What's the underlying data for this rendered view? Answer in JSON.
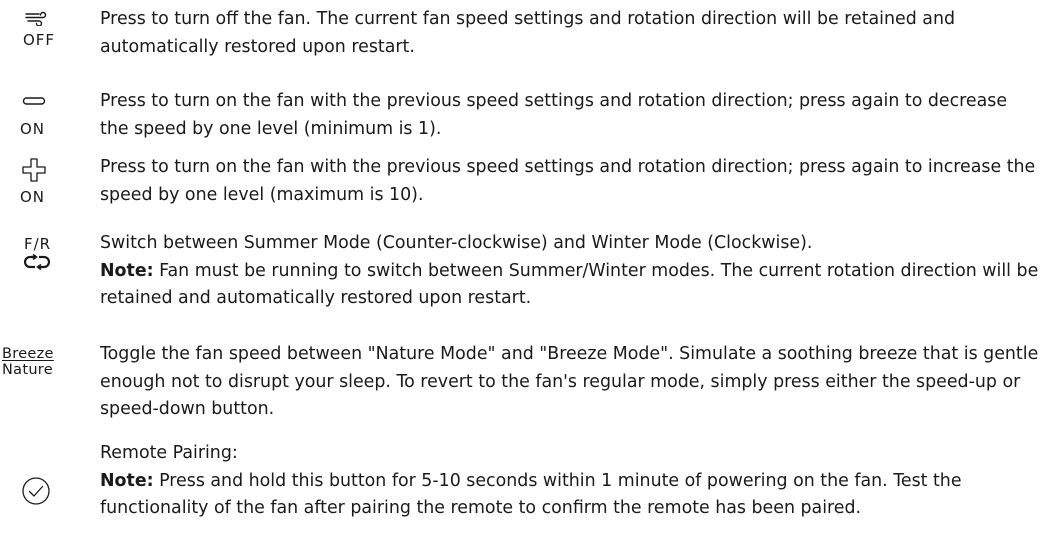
{
  "rows": [
    {
      "icon_label": "OFF",
      "text": "Press to turn off the fan. The current fan speed settings and rotation direction will be retained and automatically restored upon restart."
    },
    {
      "icon_label": "ON",
      "text": "Press to turn on the fan with the previous speed settings and rotation direction; press again to decrease the speed by one level (minimum is 1)."
    },
    {
      "icon_label": "ON",
      "text": "Press to turn on the fan with the previous speed settings and rotation direction; press again to increase the speed by one level (maximum is 10)."
    },
    {
      "icon_label": "F/R",
      "text": "Switch between Summer Mode (Counter-clockwise) and Winter Mode (Clockwise).",
      "note_label": "Note:",
      "note_text": " Fan must be running to switch between Summer/Winter modes. The current rotation direction will be retained and automatically restored upon restart."
    },
    {
      "icon_label_top": "Breeze",
      "icon_label_bottom": "Nature",
      "text": "Toggle the fan speed between \"Nature Mode\" and \"Breeze Mode\". Simulate a soothing breeze that is gentle enough not to disrupt your sleep. To revert to the fan's regular mode, simply press either the speed-up or speed-down button."
    },
    {
      "text": "Remote Pairing:",
      "note_label": "Note:",
      "note_text": " Press and hold this button for 5-10 seconds within 1 minute of powering on the fan. Test the functionality of the fan after pairing the remote to confirm the remote has been paired."
    }
  ],
  "icons": [
    "wind-off-icon",
    "minus-icon",
    "plus-icon",
    "reverse-rotation-icon",
    "breeze-nature-icon",
    "check-circle-icon"
  ]
}
